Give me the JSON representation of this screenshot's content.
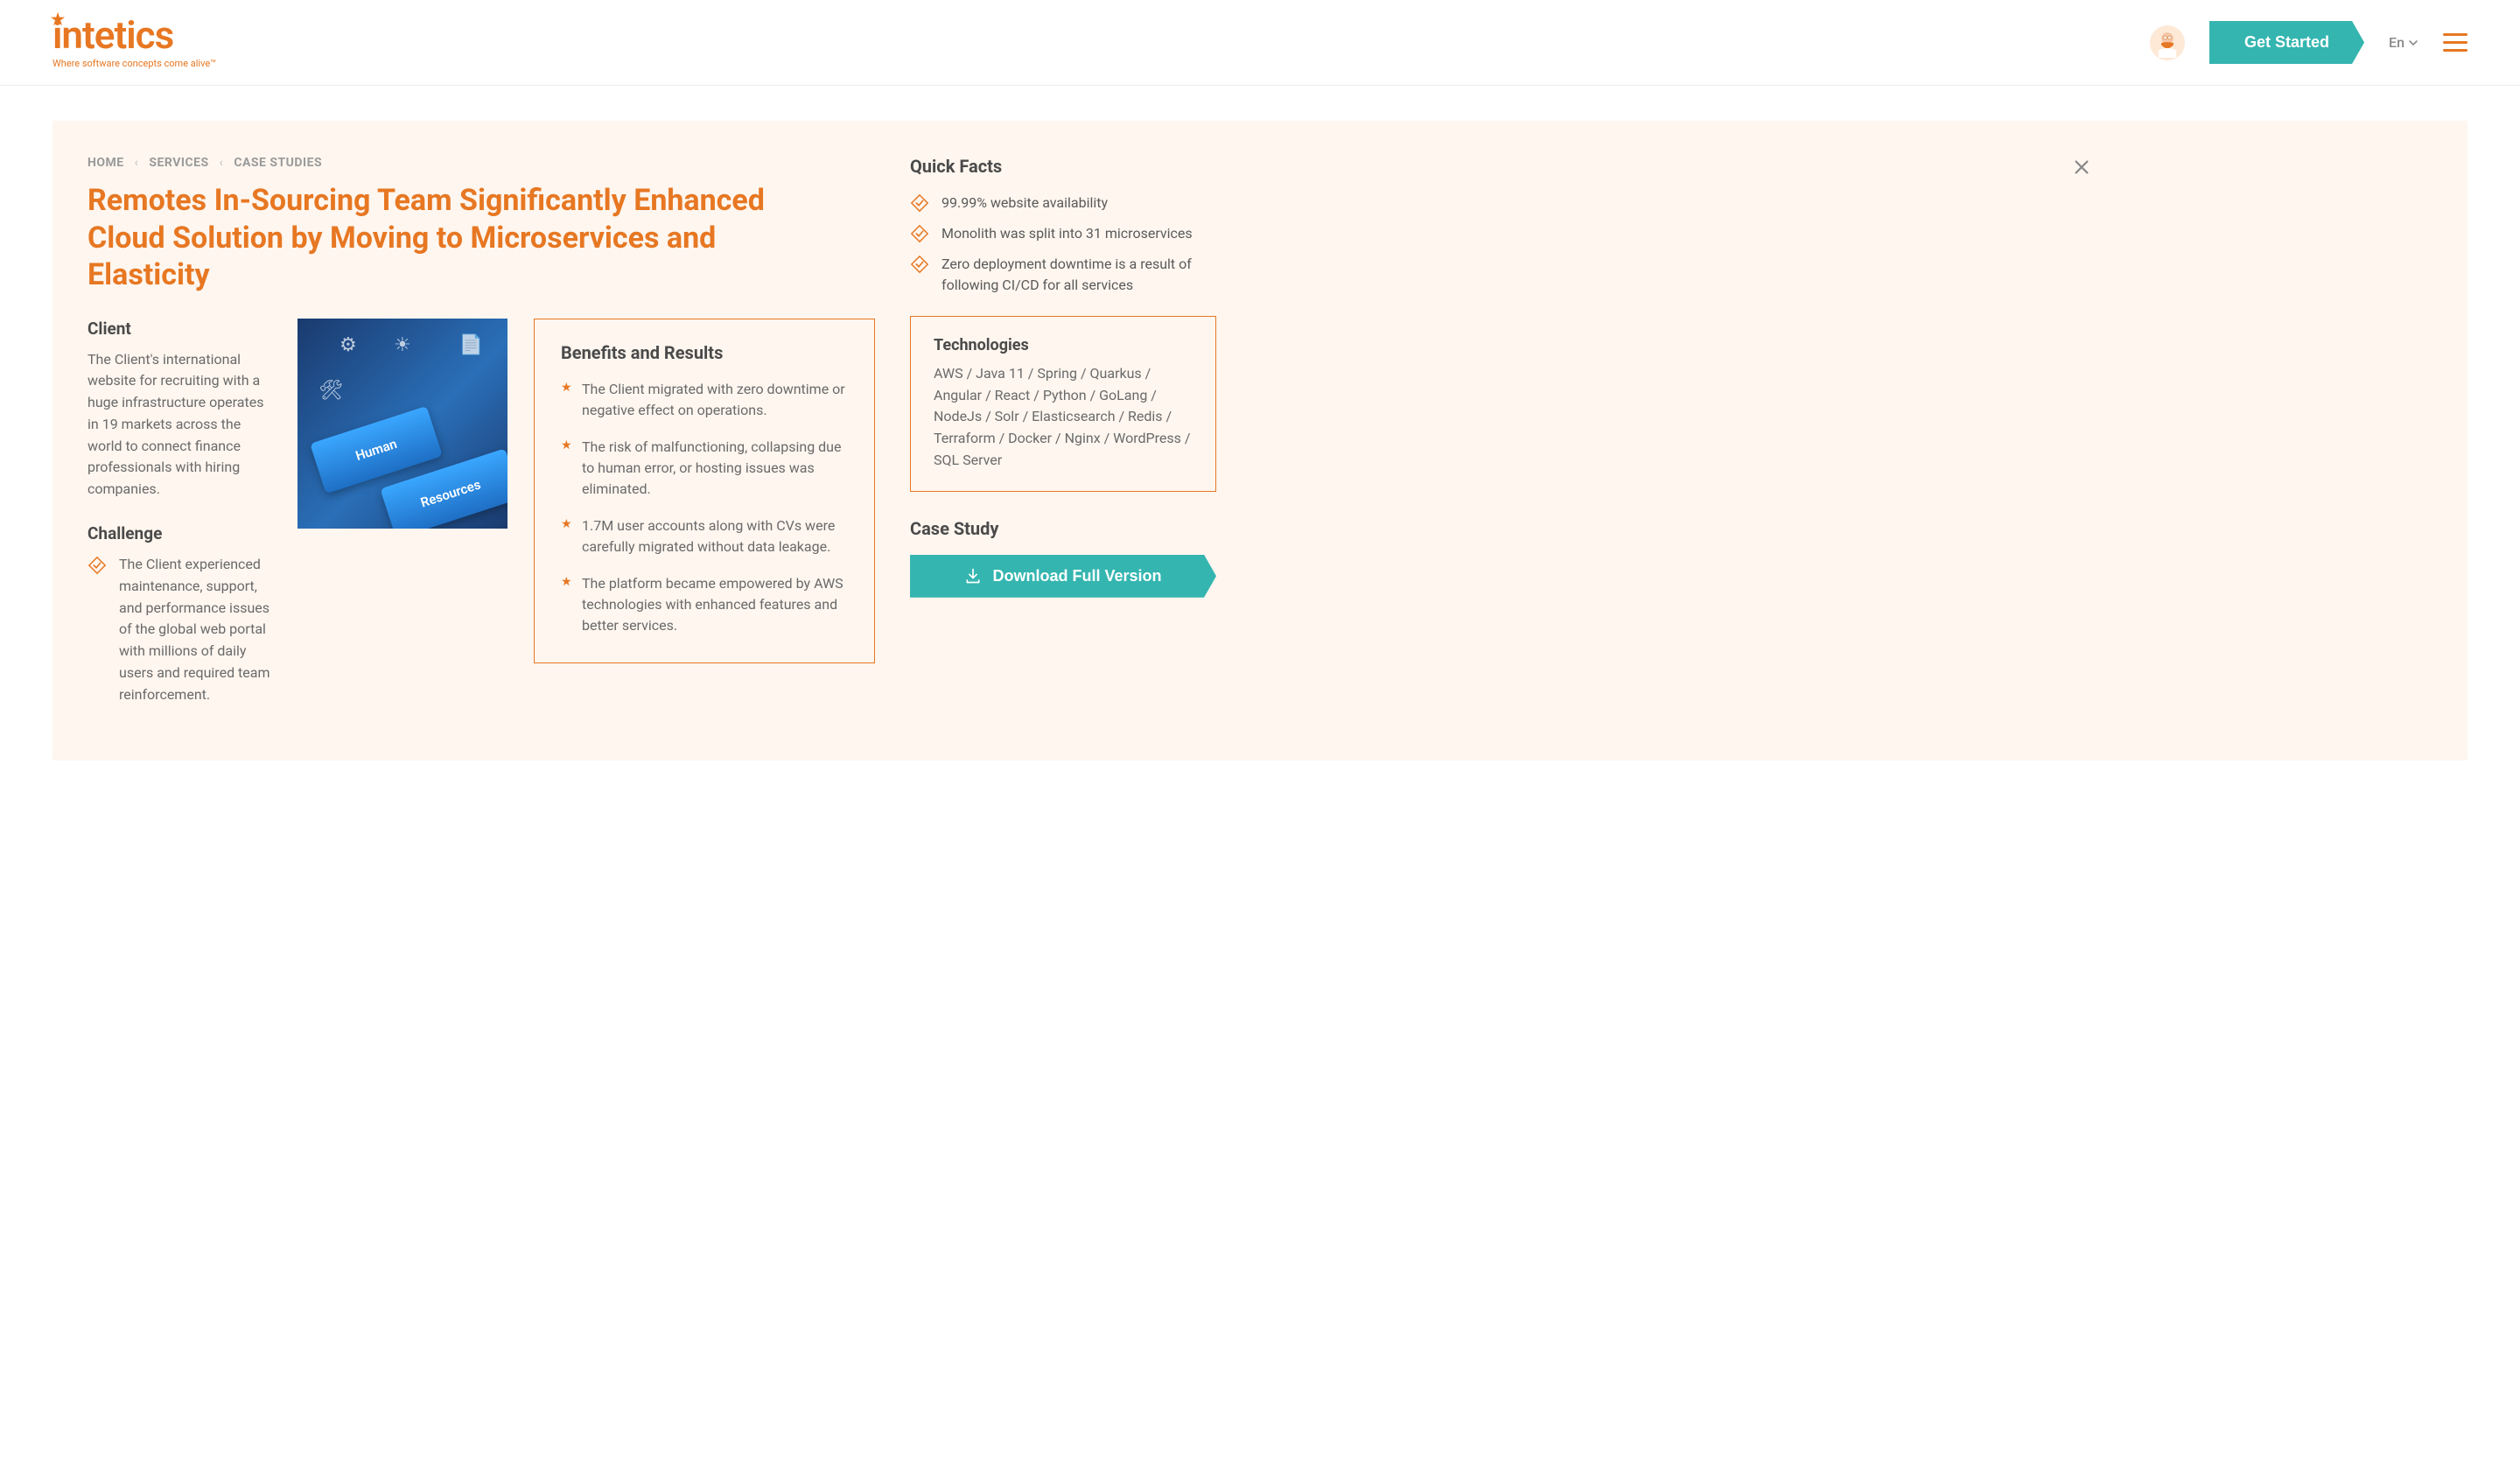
{
  "header": {
    "logo_text": "intetics",
    "logo_tagline": "Where software concepts come alive™",
    "cta_label": "Get Started",
    "lang_label": "En"
  },
  "breadcrumb": [
    "HOME",
    "SERVICES",
    "CASE STUDIES"
  ],
  "title": "Remotes In-Sourcing Team Significantly Enhanced Cloud Solution by Moving to Microservices and Elasticity",
  "client": {
    "heading": "Client",
    "body": "The Client's international website for recruiting with a huge infrastructure operates in 19 markets across the world to connect finance professionals with hiring companies."
  },
  "challenge": {
    "heading": "Challenge",
    "items": [
      "The Client experienced maintenance, support, and performance issues of the global web portal with millions of daily users and required team reinforcement."
    ]
  },
  "image": {
    "key1": "Human",
    "key2": "Resources"
  },
  "benefits": {
    "heading": "Benefits and Results",
    "items": [
      "The Client migrated with zero downtime or negative effect on operations.",
      "The risk of malfunctioning, collapsing due to human error, or hosting issues was eliminated.",
      "1.7M user accounts along with CVs were carefully migrated without data leakage.",
      "The platform became empowered by AWS technologies with enhanced features and better services."
    ]
  },
  "sidebar": {
    "quick_facts_heading": "Quick Facts",
    "quick_facts": [
      "99.99% website availability",
      "Monolith was split into 31 microservices",
      "Zero deployment downtime is a result of following CI/CD for all services"
    ],
    "tech_heading": "Technologies",
    "tech_body": "AWS / Java 11 / Spring / Quarkus / Angular / React / Python / GoLang / NodeJs / Solr / Elasticsearch / Redis / Terraform / Docker / Nginx / WordPress / SQL Server",
    "case_study_heading": "Case Study",
    "download_label": "Download Full Version"
  }
}
